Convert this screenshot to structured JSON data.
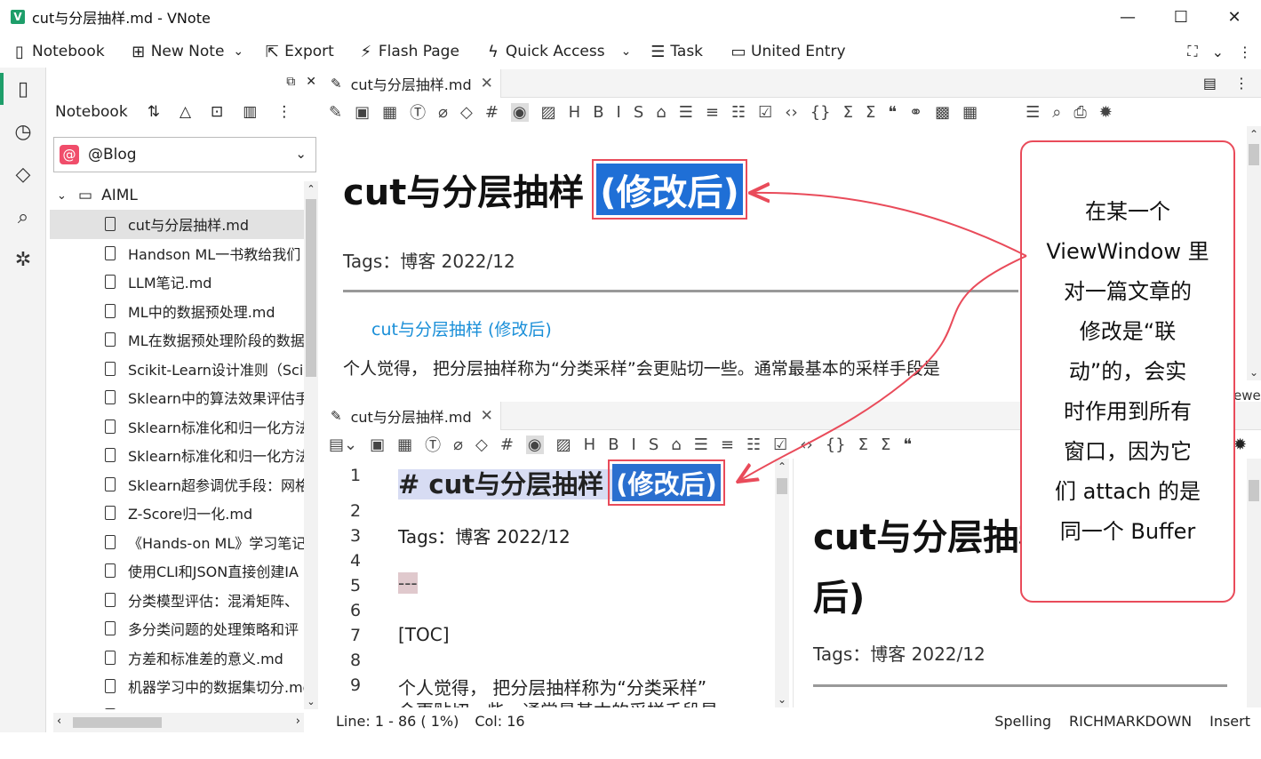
{
  "window": {
    "title": "cut与分层抽样.md - VNote",
    "logo": "V",
    "controls": {
      "minimize": "—",
      "maximize": "☐",
      "close": "✕"
    }
  },
  "toolbar": {
    "notebook": "Notebook",
    "new_note": "New Note",
    "export": "Export",
    "flash_page": "Flash Page",
    "quick_access": "Quick Access",
    "task": "Task",
    "united_entry": "United Entry",
    "icons": [
      "notebook-icon",
      "new-note-icon",
      "export-icon",
      "flash-page-icon",
      "quick-access-icon",
      "task-icon",
      "united-entry-icon"
    ]
  },
  "sidebar": {
    "header_label": "Notebook",
    "notebook_selected": "@Blog",
    "notebook_badge": "@",
    "folder": "AIML",
    "files": [
      "cut与分层抽样.md",
      "Handson ML一书教给我们",
      "LLM笔记.md",
      "ML中的数据预处理.md",
      "ML在数据预处理阶段的数据",
      "Scikit-Learn设计准则（Sci",
      "Sklearn中的算法效果评估手",
      "Sklearn标准化和归一化方法",
      "Sklearn标准化和归一化方法",
      "Sklearn超参调优手段：网格",
      "Z-Score归一化.md",
      "《Hands-on ML》学习笔记",
      "使用CLI和JSON直接创建IA",
      "分类模型评估：混淆矩阵、",
      "多分类问题的处理策略和评",
      "方差和标准差的意义.md",
      "机器学习中的数据集切分.md",
      "机器学习笔记.md"
    ],
    "selected_index": 0
  },
  "top_pane": {
    "tab_label": "cut与分层抽样.md",
    "title_main": "cut与分层抽样 ",
    "title_highlight": "(修改后)",
    "tags": "Tags：博客 2022/12",
    "toc_link": "cut与分层抽样 (修改后)",
    "paragraph": "个人觉得， 把分层抽样称为“分类采样”会更贴切一些。通常最基本的采样手段是"
  },
  "bottom_pane": {
    "tab_label": "cut与分层抽样.md",
    "line_numbers": [
      "1",
      "2",
      "3",
      "4",
      "5",
      "6",
      "7",
      "8",
      "9"
    ],
    "md_h1_prefix": "# cut与分层抽样 ",
    "md_h1_highlight": "(修改后)",
    "md_tags": "Tags：博客 2022/12",
    "md_hr": "---",
    "md_toc": "[TOC]",
    "md_para": "个人觉得， 把分层抽样称为“分类采样”",
    "md_para2": "会更贴切一些。通常最基本的采样手段是",
    "preview_title_line1": "cut与分层抽样 (修改",
    "preview_title_line2": "后)",
    "preview_tags": "Tags：博客 2022/12",
    "side_text": "ewer"
  },
  "statusbar": {
    "position": "Line: 1 - 86 ( 1%)",
    "column": "Col: 16",
    "spelling": "Spelling",
    "mode": "RICHMARKDOWN",
    "insert": "Insert"
  },
  "callout": {
    "lines": [
      "在某一个",
      "ViewWindow 里",
      "对一篇文章的",
      "修改是“联",
      "动”的，会实",
      "时作用到所有",
      "窗口，因为它",
      "们 attach 的是",
      "同一个 Buffer"
    ]
  },
  "colors": {
    "accent": "#1e9e6a",
    "highlight_blue": "#1f6fd6",
    "annotation_red": "#e94b5a",
    "link": "#1a8fd8"
  }
}
